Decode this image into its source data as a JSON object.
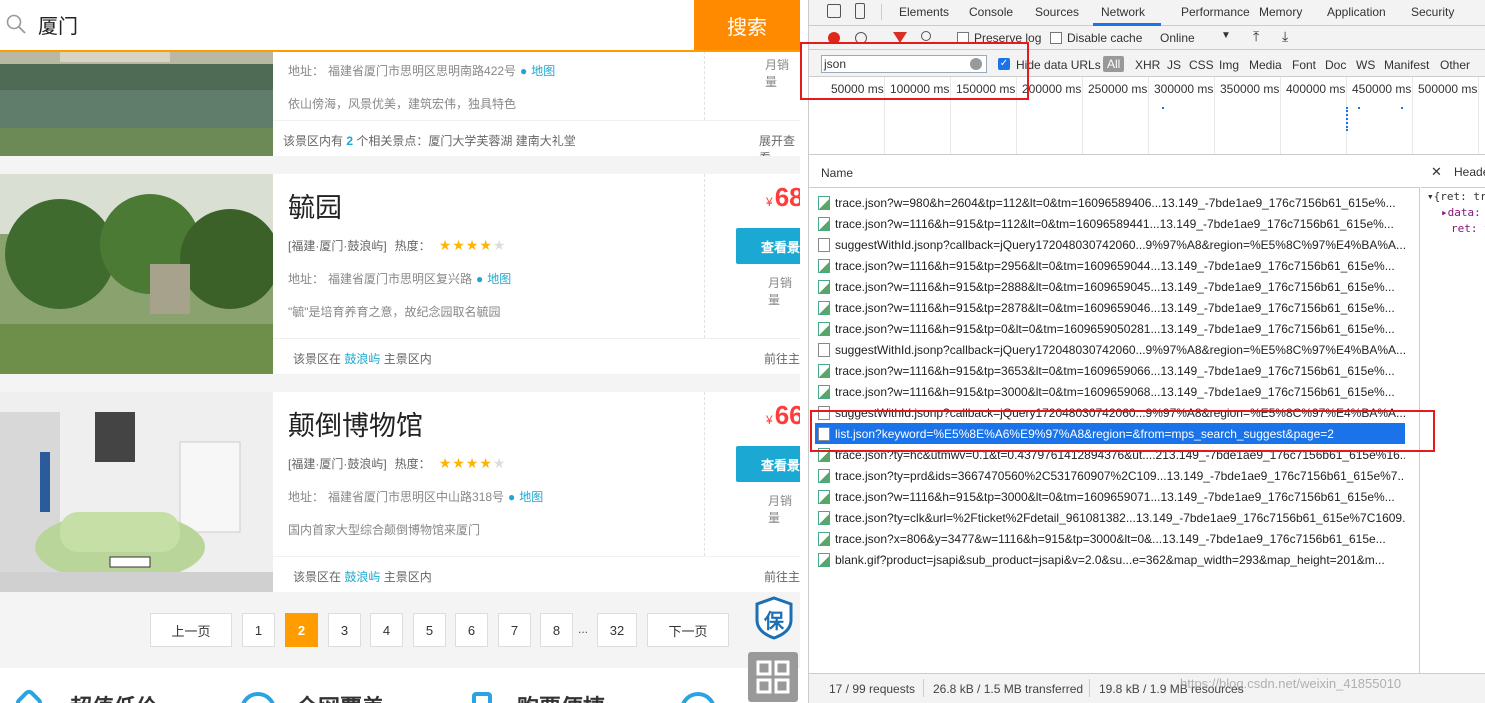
{
  "search": {
    "query": "厦门",
    "button": "搜索"
  },
  "cards": [
    {
      "address_label": "地址：",
      "address": "福建省厦门市思明区思明南路422号",
      "map_label": "地图",
      "desc": "依山傍海，风景优美，建筑宏伟，独具特色",
      "footer_left_pre": "该景区内有",
      "footer_count": "2",
      "footer_left_post": "个相关景点：厦门大学芙蓉湖   建南大礼堂",
      "footer_right": "展开查看",
      "sold": "月销量"
    },
    {
      "title": "毓园",
      "region": "[福建·厦门·鼓浪屿]",
      "hot_label": "热度：",
      "address_label": "地址：",
      "address": "福建省厦门市思明区复兴路",
      "map_label": "地图",
      "desc": "\"毓\"是培育养育之意，故纪念园取名毓园",
      "footer_left_pre": "该景区在",
      "footer_link": "鼓浪屿",
      "footer_left_post": "主景区内",
      "footer_right": "前往主",
      "price_symbol": "¥",
      "price": "68",
      "button": "查看景",
      "sold": "月销量",
      "rating": 3.5
    },
    {
      "title": "颠倒博物馆",
      "region": "[福建·厦门·鼓浪屿]",
      "hot_label": "热度：",
      "address_label": "地址：",
      "address": "福建省厦门市思明区中山路318号",
      "map_label": "地图",
      "desc": "国内首家大型综合颠倒博物馆来厦门",
      "footer_left_pre": "该景区在",
      "footer_link": "鼓浪屿",
      "footer_left_post": "主景区内",
      "footer_right": "前往主",
      "price_symbol": "¥",
      "price": "66",
      "button": "查看景",
      "sold": "月销量",
      "rating": 3.5
    }
  ],
  "pager": {
    "prev": "上一页",
    "next": "下一页",
    "dots": "...",
    "pages": [
      "1",
      "2",
      "3",
      "4",
      "5",
      "6",
      "7",
      "8",
      "32"
    ],
    "active": "2"
  },
  "bottom_features": [
    "超值低价",
    "全网覆盖",
    "购票便捷"
  ],
  "guarantee_char": "保",
  "devtools": {
    "tabs": [
      "Elements",
      "Console",
      "Sources",
      "Network",
      "Performance",
      "Memory",
      "Application",
      "Security"
    ],
    "active_tab": "Network",
    "toolbar": {
      "preserve_log": "Preserve log",
      "disable_cache": "Disable cache",
      "throttle": "Online"
    },
    "filter": {
      "value": "json",
      "hide_data_urls": "Hide data URLs",
      "types": [
        "All",
        "XHR",
        "JS",
        "CSS",
        "Img",
        "Media",
        "Font",
        "Doc",
        "WS",
        "Manifest",
        "Other"
      ]
    },
    "timeline_labels": [
      "50000 ms",
      "100000 ms",
      "150000 ms",
      "200000 ms",
      "250000 ms",
      "300000 ms",
      "350000 ms",
      "400000 ms",
      "450000 ms",
      "500000 ms"
    ],
    "column_name": "Name",
    "requests": [
      {
        "name": "trace.json?w=980&h=2604&tp=112&lt=0&tm=16096589406...13.149_-7bde1ae9_176c7156b61_615e%...",
        "icon": "img"
      },
      {
        "name": "trace.json?w=1116&h=915&tp=112&lt=0&tm=16096589441...13.149_-7bde1ae9_176c7156b61_615e%...",
        "icon": "img"
      },
      {
        "name": "suggestWithId.jsonp?callback=jQuery172048030742060...9%97%A8&region=%E5%8C%97%E4%BA%A...",
        "icon": "doc"
      },
      {
        "name": "trace.json?w=1116&h=915&tp=2956&lt=0&tm=1609659044...13.149_-7bde1ae9_176c7156b61_615e%...",
        "icon": "img"
      },
      {
        "name": "trace.json?w=1116&h=915&tp=2888&lt=0&tm=1609659045...13.149_-7bde1ae9_176c7156b61_615e%...",
        "icon": "img"
      },
      {
        "name": "trace.json?w=1116&h=915&tp=2878&lt=0&tm=1609659046...13.149_-7bde1ae9_176c7156b61_615e%...",
        "icon": "img"
      },
      {
        "name": "trace.json?w=1116&h=915&tp=0&lt=0&tm=1609659050281...13.149_-7bde1ae9_176c7156b61_615e%...",
        "icon": "img"
      },
      {
        "name": "suggestWithId.jsonp?callback=jQuery172048030742060...9%97%A8&region=%E5%8C%97%E4%BA%A...",
        "icon": "doc"
      },
      {
        "name": "trace.json?w=1116&h=915&tp=3653&lt=0&tm=1609659066...13.149_-7bde1ae9_176c7156b61_615e%...",
        "icon": "img"
      },
      {
        "name": "trace.json?w=1116&h=915&tp=3000&lt=0&tm=1609659068...13.149_-7bde1ae9_176c7156b61_615e%...",
        "icon": "img"
      },
      {
        "name": "suggestWithId.jsonp?callback=jQuery172048030742060...9%97%A8&region=%E5%8C%97%E4%BA%A...",
        "icon": "doc"
      },
      {
        "name": "list.json?keyword=%E5%8E%A6%E9%97%A8&region=&from=mps_search_suggest&page=2",
        "icon": "doc",
        "selected": true
      },
      {
        "name": "trace.json?ty=hc&utmwv=0.1&t=0.4379761412894376&ut....213.149_-7bde1ae9_176c7156b61_615e%16...",
        "icon": "img"
      },
      {
        "name": "trace.json?ty=prd&ids=3667470560%2C531760907%2C109...13.149_-7bde1ae9_176c7156b61_615e%7...",
        "icon": "img"
      },
      {
        "name": "trace.json?w=1116&h=915&tp=3000&lt=0&tm=1609659071...13.149_-7bde1ae9_176c7156b61_615e%...",
        "icon": "img"
      },
      {
        "name": "trace.json?ty=clk&url=%2Fticket%2Fdetail_961081382...13.149_-7bde1ae9_176c7156b61_615e%7C1609...",
        "icon": "img"
      },
      {
        "name": "trace.json?x=806&y=3477&w=1116&h=915&tp=3000&lt=0&...13.149_-7bde1ae9_176c7156b61_615e...",
        "icon": "img"
      },
      {
        "name": "blank.gif?product=jsapi&sub_product=jsapi&v=2.0&su...e=362&map_width=293&map_height=201&m...",
        "icon": "img"
      }
    ],
    "side_header": "Heade",
    "side_lines": [
      "▾{ret: tr",
      "▸data:",
      "ret: t"
    ],
    "status": {
      "requests": "17 / 99 requests",
      "transferred": "26.8 kB / 1.5 MB transferred",
      "resources": "19.8 kB / 1.9 MB resources"
    }
  },
  "watermark": "https://blog.csdn.net/weixin_41855010",
  "colors": {
    "accent_orange": "#ff9d00",
    "search_button": "#ff8a00",
    "link_blue": "#1ba9d3",
    "price_red": "#ff3c3c",
    "devtools_select": "#1a73e8",
    "highlight_red": "#e41b1b"
  }
}
